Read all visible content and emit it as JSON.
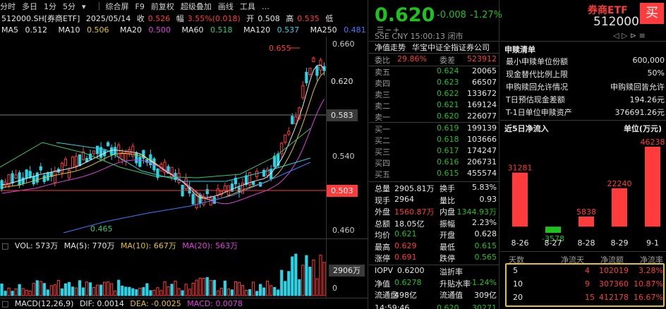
{
  "toolbar": {
    "tabs": [
      "分时",
      "多日",
      "1分",
      "5分"
    ],
    "tools": [
      "综合屏",
      "F9",
      "前复权",
      "超级叠加",
      "画线",
      "工具"
    ]
  },
  "info": {
    "code": "512000.SH[券商ETF]",
    "date": "2025/05/14",
    "close_label": "收",
    "close": "0.526",
    "change_label": "幅",
    "change": "3.55%(0.018)",
    "open_label": "开",
    "open": "0.508",
    "high_label": "高",
    "high": "0.535",
    "low_label": "低"
  },
  "ma": [
    {
      "label": "MA5",
      "value": "0.512",
      "color": "#e6e6e6"
    },
    {
      "label": "MA10",
      "value": "0.506",
      "color": "#e6c21e"
    },
    {
      "label": "MA20",
      "value": "0.500",
      "color": "#e040e0"
    },
    {
      "label": "MA60",
      "value": "0.518",
      "color": "#2ecc71"
    },
    {
      "label": "MA120",
      "value": "0.537",
      "color": "#27d5e8"
    },
    {
      "label": "MA250",
      "value": "0.481",
      "color": "#3c7cff"
    }
  ],
  "price_axis": [
    "0.660",
    "0.620",
    "0.583",
    "0.540",
    "0.503",
    "0.460"
  ],
  "annotations": {
    "high": "0.655",
    "low": "0.465"
  },
  "price_box_mid": "0.620",
  "price_box_line": "0.583",
  "price_box_red": "0.503",
  "vol": {
    "label": "VOL: 573万",
    "ma5": "MA(5): 770万",
    "ma10": "MA(10): 667万",
    "ma20": "MA(20): 563万",
    "axis_value": "2906万",
    "axis_zero": "0"
  },
  "macd": {
    "label": "MACD(12,26,9)",
    "dif": "DIF: 0.0014",
    "dea": "DEA: -0.0025",
    "macd": "MACD: 0.0078"
  },
  "quote": {
    "price": "0.620",
    "change": "-0.008",
    "change_pct": "-1.27%",
    "exchange": "SSE",
    "currency": "CNY",
    "time": "15:00:13",
    "status": "闭市",
    "nav_trend": "净值走势",
    "index_name": "华宝中证全指证券公司",
    "weibi_label": "委比",
    "weibi": "29.86%",
    "weicha_label": "委差",
    "weicha": "523912",
    "asks": [
      {
        "label": "卖五",
        "price": "0.624",
        "vol": "20065"
      },
      {
        "label": "卖四",
        "price": "0.623",
        "vol": "66507"
      },
      {
        "label": "卖三",
        "price": "0.622",
        "vol": "133672"
      },
      {
        "label": "卖二",
        "price": "0.621",
        "vol": "169124"
      },
      {
        "label": "卖一",
        "price": "0.620",
        "vol": "226077"
      }
    ],
    "bids": [
      {
        "label": "买一",
        "price": "0.619",
        "vol": "199139"
      },
      {
        "label": "买二",
        "price": "0.618",
        "vol": "103666"
      },
      {
        "label": "买三",
        "price": "0.617",
        "vol": "174247"
      },
      {
        "label": "买四",
        "price": "0.616",
        "vol": "206731"
      },
      {
        "label": "买五",
        "price": "0.615",
        "vol": "455574"
      }
    ],
    "stats": [
      {
        "l1": "总量",
        "v1": "2905.81万",
        "c1": "#e6e6e6",
        "l2": "换手",
        "v2": "5.83%",
        "c2": "#e6e6e6"
      },
      {
        "l1": "现手",
        "v1": "2964",
        "c1": "#e6e6e6",
        "l2": "量比",
        "v2": "0.93",
        "c2": "#e6e6e6"
      },
      {
        "l1": "外盘",
        "v1": "1560.87万",
        "c1": "#ff3b3b",
        "l2": "内盘",
        "v2": "1344.93万",
        "c2": "#1ec21e"
      },
      {
        "l1": "总额",
        "v1": "18.05亿",
        "c1": "#e6e6e6",
        "l2": "振幅",
        "v2": "2.23%",
        "c2": "#e6e6e6"
      },
      {
        "l1": "均价",
        "v1": "0.621",
        "c1": "#1ec21e",
        "l2": "开盘",
        "v2": "0.628",
        "c2": "#e6e6e6"
      },
      {
        "l1": "最高",
        "v1": "0.629",
        "c1": "#ff3b3b",
        "l2": "最低",
        "v2": "0.615",
        "c2": "#1ec21e"
      },
      {
        "l1": "涨停",
        "v1": "0.691",
        "c1": "#ff3b3b",
        "l2": "跌停",
        "v2": "0.565",
        "c2": "#1ec21e"
      }
    ],
    "stats2": [
      {
        "l1": "IOPV",
        "v1": "0.6200",
        "c1": "#e6e6e6",
        "l2": "溢折率",
        "v2": "",
        "c2": "#e6e6e6"
      },
      {
        "l1": "净值",
        "v1": "0.6278",
        "c1": "#1ec21e",
        "l2": "升贴水率",
        "v2": "-1.24%",
        "c2": "#1ec21e"
      },
      {
        "l1": "流通盘",
        "v1": "498亿",
        "c1": "#e6e6e6",
        "l2": "流通值",
        "v2": "309亿",
        "c2": "#e6e6e6"
      }
    ],
    "last_trade": {
      "time": "14:59:46",
      "price": "0.620",
      "vol": "30271"
    }
  },
  "right": {
    "name": "券商ETF",
    "code": "512000",
    "buy_label": "买",
    "creation_title": "申赎清单",
    "creation": [
      {
        "label": "最小申赎单位份额",
        "value": "600,000"
      },
      {
        "label": "现金替代比例上限",
        "value": "50%"
      },
      {
        "label": "申购赎回允许情况",
        "value": "申购赎回皆允许"
      },
      {
        "label": "T日预估现金差额",
        "value": "194.26元"
      },
      {
        "label": "T-1日单位申赎资产",
        "value": "376691.26元"
      }
    ],
    "flow_title": "近5日净流入",
    "flow_unit": "单位(万元)",
    "period_header": [
      "天数",
      "净流天",
      "净流额",
      "净流率"
    ],
    "periods": [
      {
        "days": "5",
        "flow_days": "4",
        "amount": "102019",
        "rate": "3.28%"
      },
      {
        "days": "10",
        "flow_days": "9",
        "amount": "307360",
        "rate": "10.87%"
      },
      {
        "days": "20",
        "flow_days": "15",
        "amount": "412178",
        "rate": "16.67%"
      }
    ]
  },
  "chart_data": {
    "type": "bar",
    "title": "近5日净流入",
    "ylabel": "单位(万元)",
    "categories": [
      "8-26",
      "8-27",
      "8-28",
      "8-29",
      "9-1"
    ],
    "values": [
      31281,
      -3578,
      5838,
      22240,
      46238
    ],
    "ylim": [
      -3578,
      46238
    ]
  }
}
